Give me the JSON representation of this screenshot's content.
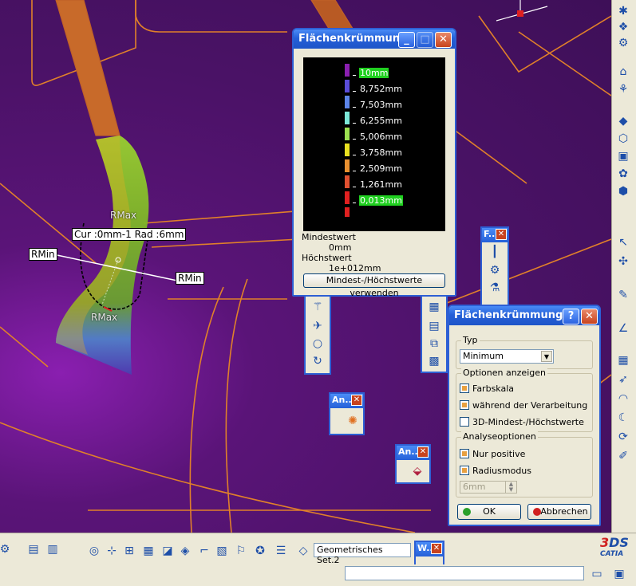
{
  "viewport": {
    "labels": {
      "rmax_top": "RMax",
      "rmax_bottom": "RMax",
      "rmin_left": "RMin",
      "rmin_right": "RMin",
      "curvature_readout": "Cur :0mm-1  Rad :6mm"
    }
  },
  "curvature_window": {
    "title": "Flächenkrümmun...",
    "scale": [
      {
        "label": "10mm",
        "color": "#8a1fb0",
        "highlight": true
      },
      {
        "label": "8,752mm",
        "color": "#5a4cd8",
        "highlight": false
      },
      {
        "label": "7,503mm",
        "color": "#5c84e8",
        "highlight": false
      },
      {
        "label": "6,255mm",
        "color": "#7ce8d8",
        "highlight": false
      },
      {
        "label": "5,006mm",
        "color": "#9ce050",
        "highlight": false
      },
      {
        "label": "3,758mm",
        "color": "#e8e020",
        "highlight": false
      },
      {
        "label": "2,509mm",
        "color": "#e89030",
        "highlight": false
      },
      {
        "label": "1,261mm",
        "color": "#e05030",
        "highlight": false
      },
      {
        "label": "0,013mm",
        "color": "#e02020",
        "highlight": true
      }
    ],
    "min_label": "Mindestwert",
    "min_value": "0mm",
    "max_label": "Höchstwert",
    "max_value": "1e+012mm",
    "use_button": "Mindest-/Höchstwerte verwenden"
  },
  "analysis_dialog": {
    "title": "Flächenkrümmung",
    "help": "?",
    "type_group": "Typ",
    "type_value": "Minimum",
    "display_group": "Optionen anzeigen",
    "display_options": [
      {
        "label": "Farbskala",
        "checked": true
      },
      {
        "label": "während der Verarbeitung",
        "checked": true
      },
      {
        "label": "3D-Mindest-/Höchstwerte",
        "checked": false
      }
    ],
    "analysis_group": "Analyseoptionen",
    "analysis_options": [
      {
        "label": "Nur positive",
        "checked": true
      },
      {
        "label": "Radiusmodus",
        "checked": true
      }
    ],
    "radius_value": "6mm",
    "ok": "OK",
    "cancel": "Abbrechen"
  },
  "floating_toolbars": {
    "f_title": "F...",
    "an1_title": "An...",
    "an2_title": "An...",
    "w_title": "W..."
  },
  "bottom_toolbar": {
    "geometry_set": "Geometrisches Set.2"
  },
  "brand": "CATIA"
}
